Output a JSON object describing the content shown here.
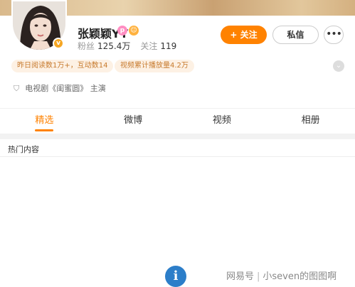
{
  "profile": {
    "name": "张颖颖YY",
    "level_icon": "p",
    "verified_badge": "v",
    "fans_label": "粉丝",
    "fans_count": "125.4万",
    "following_label": "关注",
    "following_count": "119"
  },
  "actions": {
    "follow_label": "+ 关注",
    "message_label": "私信",
    "more_label": "•••"
  },
  "tags": [
    "昨日阅读数1万+，互动数14",
    "视频累计播放量4.2万"
  ],
  "certification": "电视剧《闺蜜圆》 主演",
  "tabs": [
    {
      "label": "精选",
      "active": true
    },
    {
      "label": "微博",
      "active": false
    },
    {
      "label": "视频",
      "active": false
    },
    {
      "label": "相册",
      "active": false
    }
  ],
  "section": {
    "title": "热门内容"
  },
  "watermark": {
    "source": "网易号",
    "author": "小seven的图图啊"
  },
  "colors": {
    "accent": "#ff8200",
    "tag_bg": "#fdf1e4",
    "tag_text": "#c77a2d",
    "info_icon": "#2c7ec9"
  },
  "icons": [
    "verified-icon",
    "level-icon",
    "emoji-icon",
    "expand-icon",
    "shield-icon",
    "info-icon"
  ]
}
